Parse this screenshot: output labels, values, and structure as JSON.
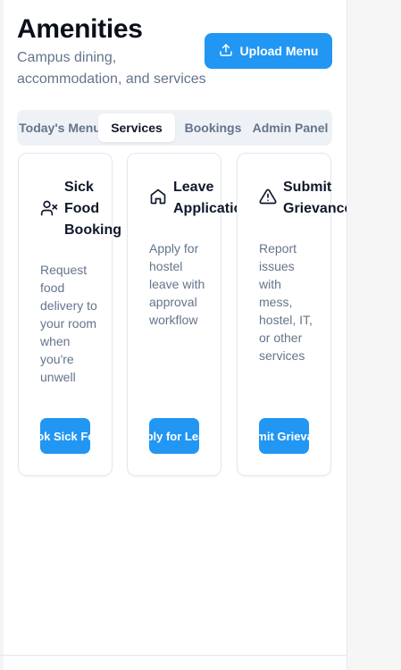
{
  "header": {
    "title": "Amenities",
    "subtitle": "Campus dining, accommodation, and services",
    "upload_button": "Upload Menu",
    "upload_icon": "upload-icon"
  },
  "tabs": [
    {
      "label": "Today's Menu",
      "active": false
    },
    {
      "label": "Services",
      "active": true
    },
    {
      "label": "Bookings",
      "active": false
    },
    {
      "label": "Admin Panel",
      "active": false
    }
  ],
  "cards": [
    {
      "icon": "user-x-icon",
      "title": "Sick\nFood\nBooking",
      "description": "Request food delivery to your room when you're unwell",
      "button": "Book Sick Food"
    },
    {
      "icon": "home-icon",
      "title": "Leave\nApplication",
      "description": "Apply for hostel leave with approval workflow",
      "button": "Apply for Leave"
    },
    {
      "icon": "alert-triangle-icon",
      "title": "Submit\nGrievance",
      "description": "Report issues with mess, hostel, IT, or other services",
      "button": "Submit Grievance"
    }
  ],
  "colors": {
    "accent": "#2196f3",
    "muted_text": "#64748b",
    "tab_bg": "#eef2f6"
  }
}
